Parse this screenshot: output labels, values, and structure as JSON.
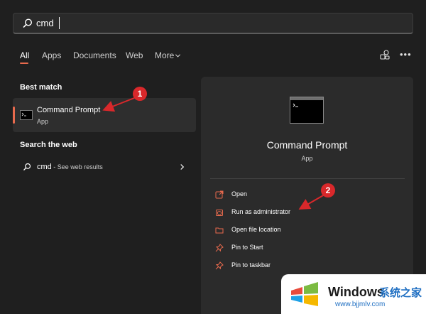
{
  "search": {
    "value": "cmd"
  },
  "tabs": [
    {
      "label": "All"
    },
    {
      "label": "Apps"
    },
    {
      "label": "Documents"
    },
    {
      "label": "Web"
    },
    {
      "label": "More"
    }
  ],
  "best_match": {
    "section_title": "Best match",
    "name": "Command Prompt",
    "type": "App"
  },
  "web": {
    "section_title": "Search the web",
    "query": "cmd",
    "suffix": " - See web results"
  },
  "detail": {
    "title": "Command Prompt",
    "type": "App",
    "actions": [
      {
        "label": "Open",
        "icon": "open-icon"
      },
      {
        "label": "Run as administrator",
        "icon": "shield-icon"
      },
      {
        "label": "Open file location",
        "icon": "folder-icon"
      },
      {
        "label": "Pin to Start",
        "icon": "pin-icon"
      },
      {
        "label": "Pin to taskbar",
        "icon": "pin-icon"
      }
    ]
  },
  "annotations": {
    "badge_1": "1",
    "badge_2": "2"
  },
  "watermark": {
    "brand": "Windows",
    "cn": "系统之家",
    "url": "www.bjjmlv.com"
  },
  "colors": {
    "accent": "#e86a4d",
    "badge": "#d9282b",
    "background": "#1f1f1f",
    "panel": "#2b2b2b"
  }
}
